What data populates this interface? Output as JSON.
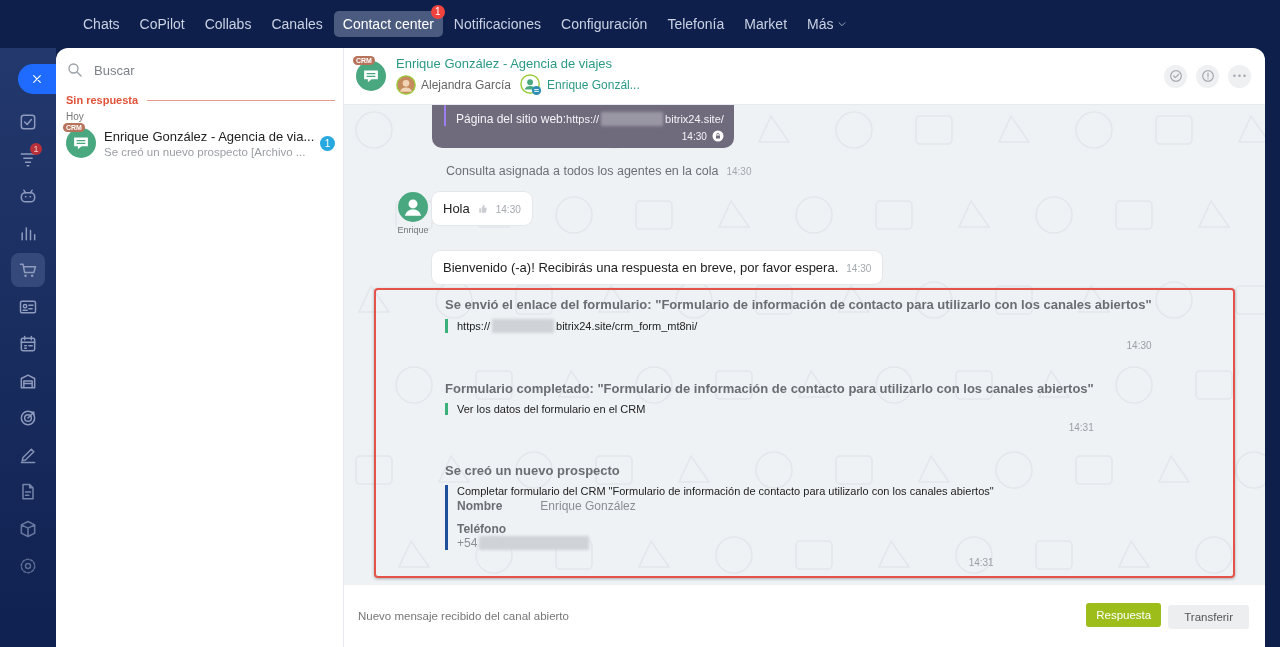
{
  "nav": {
    "items": [
      {
        "label": "Chats",
        "selected": false
      },
      {
        "label": "CoPilot",
        "selected": false
      },
      {
        "label": "Collabs",
        "selected": false
      },
      {
        "label": "Canales",
        "selected": false
      },
      {
        "label": "Contact center",
        "selected": true,
        "badge": "1"
      },
      {
        "label": "Notificaciones",
        "selected": false
      },
      {
        "label": "Configuración",
        "selected": false
      },
      {
        "label": "Telefonía",
        "selected": false
      },
      {
        "label": "Market",
        "selected": false
      },
      {
        "label": "Más",
        "selected": false,
        "dropdown": true
      }
    ]
  },
  "rail": {
    "items": [
      {
        "kind": "close"
      },
      {
        "kind": "tasks",
        "selected": false
      },
      {
        "kind": "filter",
        "selected": false,
        "badge": "1"
      },
      {
        "kind": "robot",
        "selected": false
      },
      {
        "kind": "chart",
        "selected": false
      },
      {
        "kind": "cart",
        "selected": true
      },
      {
        "kind": "card",
        "selected": false
      },
      {
        "kind": "calendar",
        "selected": false
      },
      {
        "kind": "store",
        "selected": false
      },
      {
        "kind": "target",
        "selected": false
      },
      {
        "kind": "pen",
        "selected": false
      },
      {
        "kind": "doc",
        "selected": false
      },
      {
        "kind": "cube",
        "selected": false
      },
      {
        "kind": "settings",
        "selected": false
      }
    ]
  },
  "chat_list": {
    "search": {
      "placeholder": "Buscar"
    },
    "section": "Sin respuesta",
    "date": "Hoy",
    "items": [
      {
        "badge": "CRM",
        "title": "Enrique González - Agencia de via...",
        "preview": "Se creó un nuevo prospecto [Archivo ...",
        "count": "1"
      }
    ]
  },
  "header": {
    "badge": "CRM",
    "title": "Enrique González - Agencia de viajes",
    "participants": [
      {
        "kind": "operator",
        "name": "Alejandra García"
      },
      {
        "kind": "client",
        "name": "Enrique Gonzál..."
      }
    ]
  },
  "messages": [
    {
      "kind": "system_card",
      "label": "Página del sitio web:",
      "url_start": "https://",
      "url_end": "bitrix24.site/",
      "time": "14:30"
    },
    {
      "kind": "note",
      "text": "Consulta asignada a todos los agentes en la cola",
      "time": "14:30"
    },
    {
      "kind": "incoming",
      "author": "Enrique",
      "text": "Hola",
      "time": "14:30",
      "like": true
    },
    {
      "kind": "incoming",
      "text": "Bienvenido (-a)! Recibirás una respuesta en breve, por favor espera.",
      "time": "14:30",
      "like": false
    }
  ],
  "highlighted": {
    "events": [
      {
        "title": "Se envió el enlace del formulario: \"Formulario de información de contacto para utilizarlo con los canales abiertos\"",
        "color": "#3bb07a",
        "link_start": "https://",
        "link_end": "bitrix24.site/crm_form_mt8ni/",
        "time": "14:30"
      },
      {
        "title": "Formulario completado: \"Formulario de información de contacto para utilizarlo con los canales abiertos\"",
        "color": "#3bb07a",
        "text": "Ver los datos del formulario en el CRM",
        "time": "14:31"
      },
      {
        "title": "Se creó un nuevo prospecto",
        "color": "#1f4f9c",
        "text": "Completar formulario del CRM \"Formulario de información de contacto para utilizarlo con los canales abiertos\"",
        "fields": [
          {
            "kind": "inline",
            "label": "Nombre",
            "value": "Enrique González"
          },
          {
            "kind": "stacked",
            "label": "Teléfono",
            "value": "+54",
            "redacted": true
          }
        ],
        "time": "14:31"
      }
    ]
  },
  "footer": {
    "status": "Nuevo mensaje recibido del canal abierto",
    "buttons": [
      {
        "label": "Respuesta",
        "kind": "primary"
      },
      {
        "label": "Transferir",
        "kind": "secondary"
      }
    ]
  }
}
